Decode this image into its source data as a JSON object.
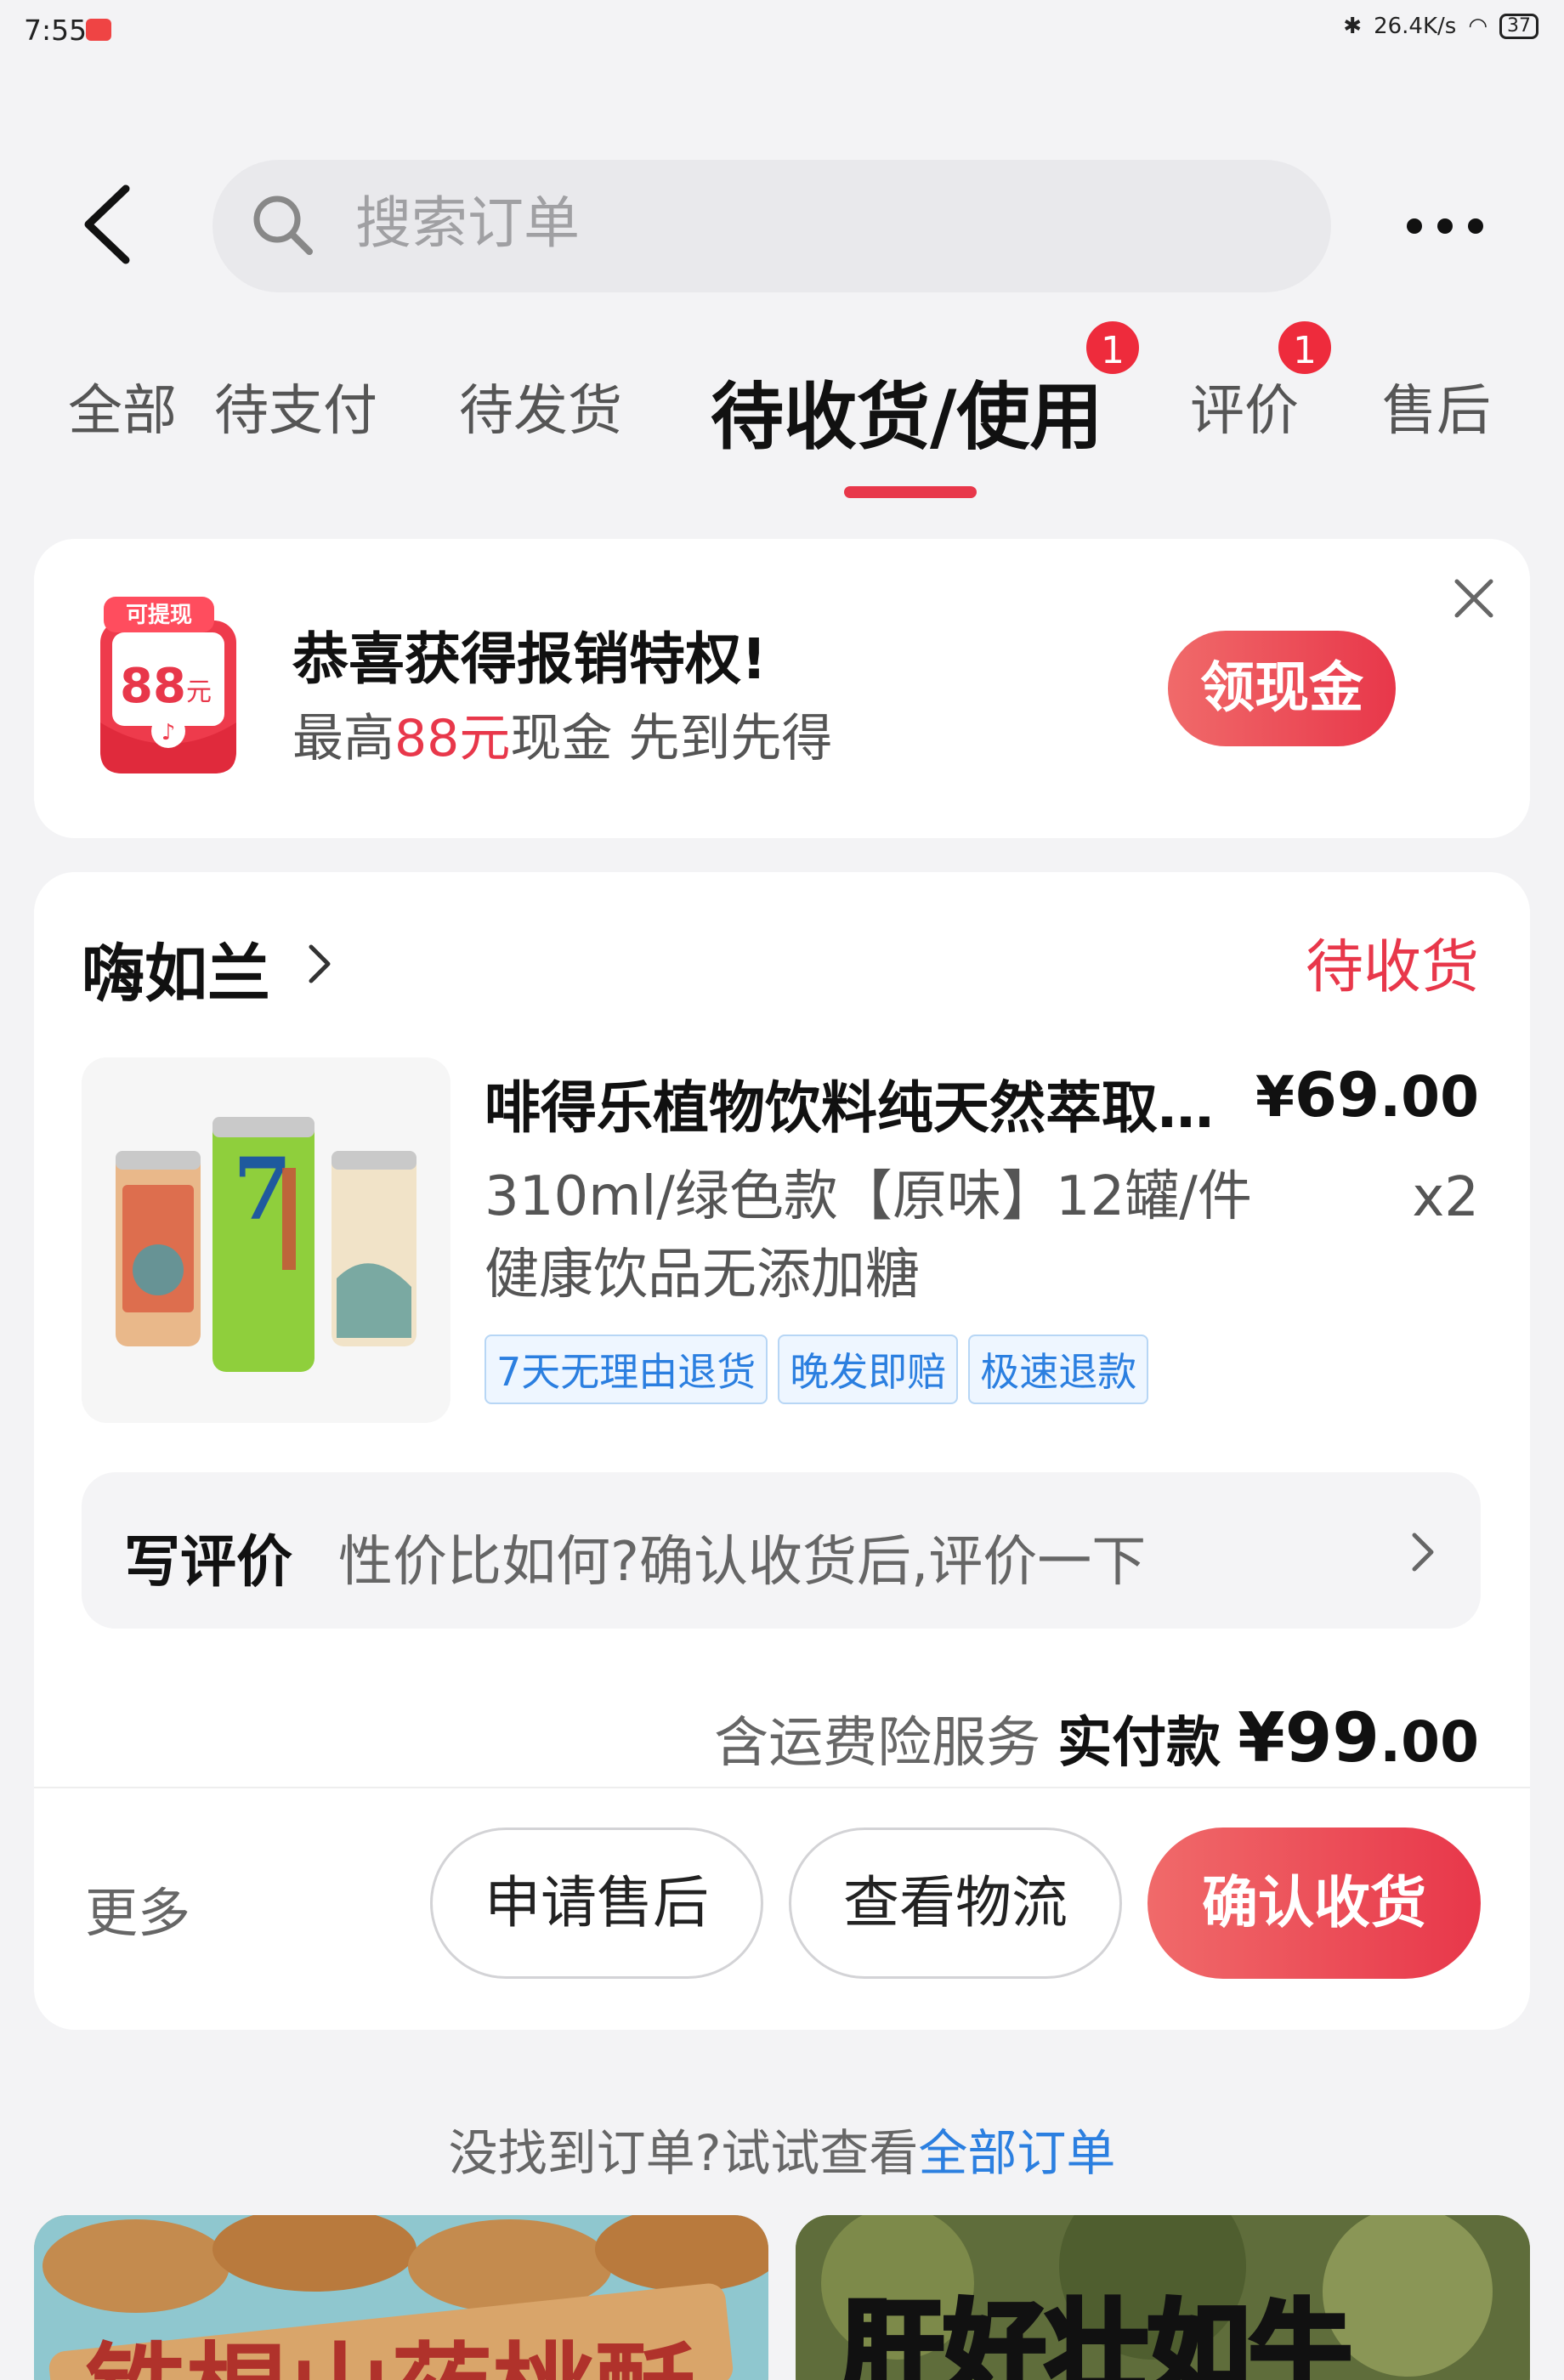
{
  "status_bar": {
    "time": "7:55",
    "network_speed": "26.4K/s",
    "battery": "37"
  },
  "header": {
    "search_placeholder": "搜索订单"
  },
  "tabs": [
    {
      "label": "全部"
    },
    {
      "label": "待支付"
    },
    {
      "label": "待发货"
    },
    {
      "label": "待收货/使用",
      "active": true,
      "badge": "1"
    },
    {
      "label": "评价",
      "badge": "1"
    },
    {
      "label": "售后"
    }
  ],
  "promo": {
    "icon_top_text": "可提现",
    "icon_amount": "88",
    "icon_unit": "元",
    "title": "恭喜获得报销特权!",
    "sub_prefix": "最高",
    "sub_highlight": "88元",
    "sub_suffix": "现金 先到先得",
    "button": "领现金"
  },
  "order": {
    "shop_name": "嗨如兰",
    "status": "待收货",
    "product_title": "啡得乐植物饮料纯天然萃取…",
    "price_symbol": "¥",
    "price_int": "69",
    "price_dec": ".00",
    "spec_line1": "310ml/绿色款【原味】12罐/件",
    "spec_line2": "健康饮品无添加糖",
    "quantity": "x2",
    "tags": [
      "7天无理由退货",
      "晚发即赔",
      "极速退款"
    ],
    "review_label": "写评价",
    "review_hint": "性价比如何?确认收货后,评价一下",
    "total_note": "含运费险服务",
    "total_label": "实付款",
    "total_symbol": "¥",
    "total_int": "99",
    "total_dec": ".00",
    "more": "更多",
    "btn_after_sale": "申请售后",
    "btn_logistics": "查看物流",
    "btn_confirm": "确认收货"
  },
  "footer": {
    "not_found_text": "没找到订单?试试查看",
    "not_found_link": "全部订单"
  },
  "recommendations": [
    {
      "overlay": "铁棍山药桃酥"
    },
    {
      "overlay": "肝好壮如牛"
    }
  ],
  "colors": {
    "accent": "#e8374a",
    "link": "#2b7fe0",
    "background": "#f3f3f5"
  }
}
